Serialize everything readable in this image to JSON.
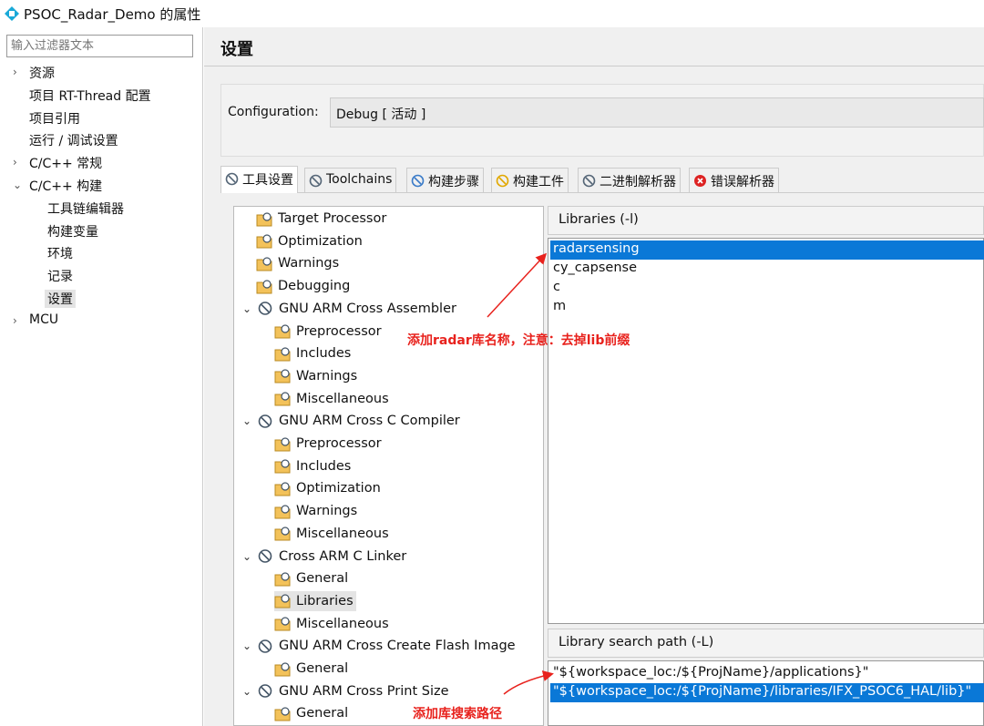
{
  "window": {
    "title": "PSOC_Radar_Demo 的属性"
  },
  "left": {
    "filter_placeholder": "输入过滤器文本",
    "items": [
      {
        "label": "资源",
        "chev": "›",
        "level": 0
      },
      {
        "label": "项目 RT-Thread 配置",
        "chev": "",
        "level": 0
      },
      {
        "label": "项目引用",
        "chev": "",
        "level": 0
      },
      {
        "label": "运行 / 调试设置",
        "chev": "",
        "level": 0
      },
      {
        "label": "C/C++ 常规",
        "chev": "›",
        "level": 0
      },
      {
        "label": "C/C++ 构建",
        "chev": "⌄",
        "level": 0
      },
      {
        "label": "工具链编辑器",
        "chev": "",
        "level": 1
      },
      {
        "label": "构建变量",
        "chev": "",
        "level": 1
      },
      {
        "label": "环境",
        "chev": "",
        "level": 1
      },
      {
        "label": "记录",
        "chev": "",
        "level": 1
      },
      {
        "label": "设置",
        "chev": "",
        "level": 1,
        "selected": true
      },
      {
        "label": "MCU",
        "chev": "›",
        "level": 0
      }
    ]
  },
  "main": {
    "title": "设置",
    "config_label": "Configuration:",
    "config_value": "Debug  [ 活动 ]",
    "tabs": [
      {
        "label": "工具设置",
        "icon": "tool-settings-icon"
      },
      {
        "label": "Toolchains",
        "icon": "toolchains-icon"
      },
      {
        "label": "构建步骤",
        "icon": "build-steps-icon"
      },
      {
        "label": "构建工件",
        "icon": "build-artifact-icon"
      },
      {
        "label": "二进制解析器",
        "icon": "binary-parser-icon"
      },
      {
        "label": "错误解析器",
        "icon": "error-parser-icon"
      }
    ],
    "tree": [
      {
        "label": "Target Processor",
        "level": 1
      },
      {
        "label": "Optimization",
        "level": 1
      },
      {
        "label": "Warnings",
        "level": 1
      },
      {
        "label": "Debugging",
        "level": 1
      },
      {
        "label": "GNU ARM Cross Assembler",
        "level": 0
      },
      {
        "label": "Preprocessor",
        "level": 2
      },
      {
        "label": "Includes",
        "level": 2
      },
      {
        "label": "Warnings",
        "level": 2
      },
      {
        "label": "Miscellaneous",
        "level": 2
      },
      {
        "label": "GNU ARM Cross C Compiler",
        "level": 0
      },
      {
        "label": "Preprocessor",
        "level": 2
      },
      {
        "label": "Includes",
        "level": 2
      },
      {
        "label": "Optimization",
        "level": 2
      },
      {
        "label": "Warnings",
        "level": 2
      },
      {
        "label": "Miscellaneous",
        "level": 2
      },
      {
        "label": "Cross ARM C Linker",
        "level": 0
      },
      {
        "label": "General",
        "level": 2
      },
      {
        "label": "Libraries",
        "level": 2,
        "selected": true
      },
      {
        "label": "Miscellaneous",
        "level": 2
      },
      {
        "label": "GNU ARM Cross Create Flash Image",
        "level": 0
      },
      {
        "label": "General",
        "level": 2
      },
      {
        "label": "GNU ARM Cross Print Size",
        "level": 0
      },
      {
        "label": "General",
        "level": 2
      }
    ],
    "libraries": {
      "header": "Libraries (-l)",
      "items": [
        "radarsensing",
        "cy_capsense",
        "c",
        "m"
      ],
      "selected": 0
    },
    "search_path": {
      "header": "Library search path (-L)",
      "items": [
        "\"${workspace_loc:/${ProjName}/applications}\"",
        "\"${workspace_loc:/${ProjName}/libraries/IFX_PSOC6_HAL/lib}\""
      ],
      "selected": 1
    }
  },
  "annotations": {
    "lib_note": "添加radar库名称，注意：去掉lib前缀",
    "path_note": "添加库搜索路径",
    "color": "#e8221d"
  },
  "colors": {
    "selection": "#0a78d7",
    "accent": "#e8221d"
  }
}
